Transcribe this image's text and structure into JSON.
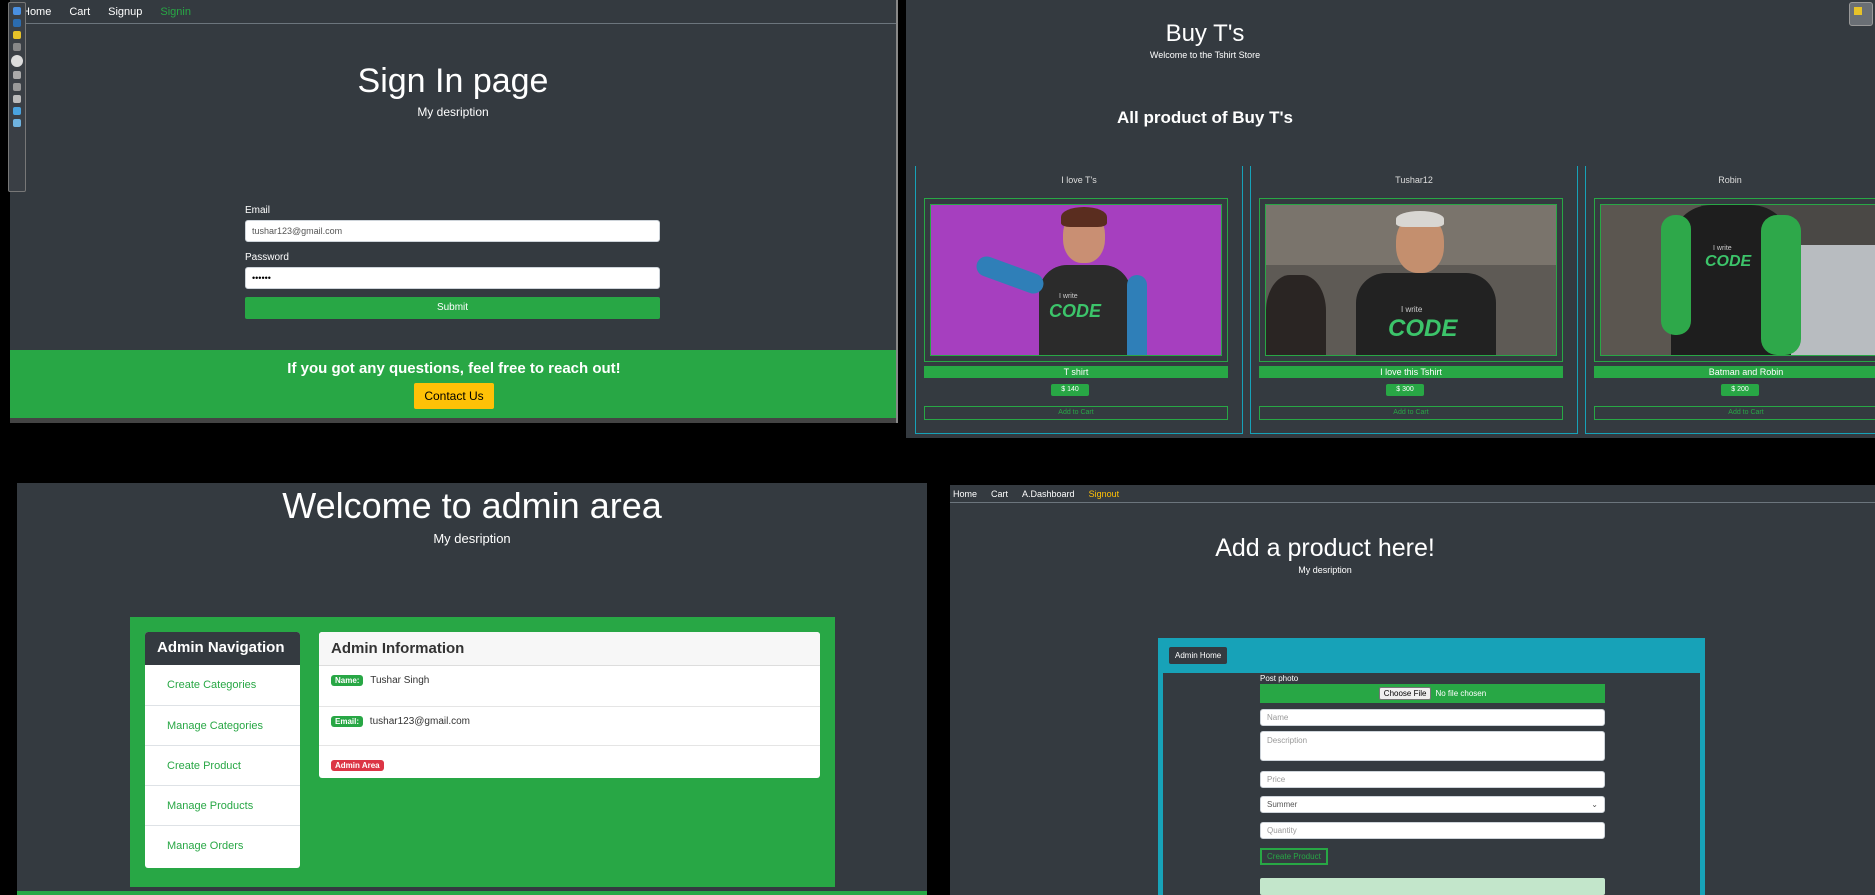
{
  "signin": {
    "nav": [
      "Home",
      "Cart",
      "Signup",
      "Signin"
    ],
    "title": "Sign In page",
    "subtitle": "My desription",
    "email_label": "Email",
    "email_value": "tushar123@gmail.com",
    "password_label": "Password",
    "password_value": "••••••",
    "submit_label": "Submit",
    "footer_text": "If you got any questions, feel free to reach out!",
    "contact_label": "Contact Us"
  },
  "store": {
    "title": "Buy T's",
    "subtitle": "Welcome to the Tshirt Store",
    "heading": "All product of Buy T's",
    "products": [
      {
        "header": "I love T's",
        "name": "T shirt",
        "price": "$ 140",
        "cart_label": "Add to Cart"
      },
      {
        "header": "Tushar12",
        "name": "I love this Tshirt",
        "price": "$ 300",
        "cart_label": "Add to Cart"
      },
      {
        "header": "Robin",
        "name": "Batman and Robin",
        "price": "$ 200",
        "cart_label": "Add to Cart"
      }
    ],
    "shirt_text_small": "I write",
    "shirt_text_big": "CODE"
  },
  "admin": {
    "title": "Welcome to admin area",
    "subtitle": "My desription",
    "nav_heading": "Admin Navigation",
    "nav_items": [
      "Create Categories",
      "Manage Categories",
      "Create Product",
      "Manage Products",
      "Manage Orders"
    ],
    "info_heading": "Admin Information",
    "name_badge": "Name:",
    "name_value": "Tushar Singh",
    "email_badge": "Email:",
    "email_value": "tushar123@gmail.com",
    "area_badge": "Admin Area"
  },
  "addproduct": {
    "nav": [
      "Home",
      "Cart",
      "A.Dashboard",
      "Signout"
    ],
    "title": "Add a product here!",
    "subtitle": "My desription",
    "admin_home": "Admin Home",
    "post_photo": "Post photo",
    "choose_file": "Choose File",
    "no_file": "No file chosen",
    "name_ph": "Name",
    "desc_ph": "Description",
    "price_ph": "Price",
    "category_value": "Summer",
    "qty_ph": "Quantity",
    "create_label": "Create Product"
  },
  "colors": {
    "bg": "#343a40",
    "green": "#28a745",
    "yellow": "#ffc107",
    "red": "#dc3545",
    "teal": "#17a2b8"
  }
}
